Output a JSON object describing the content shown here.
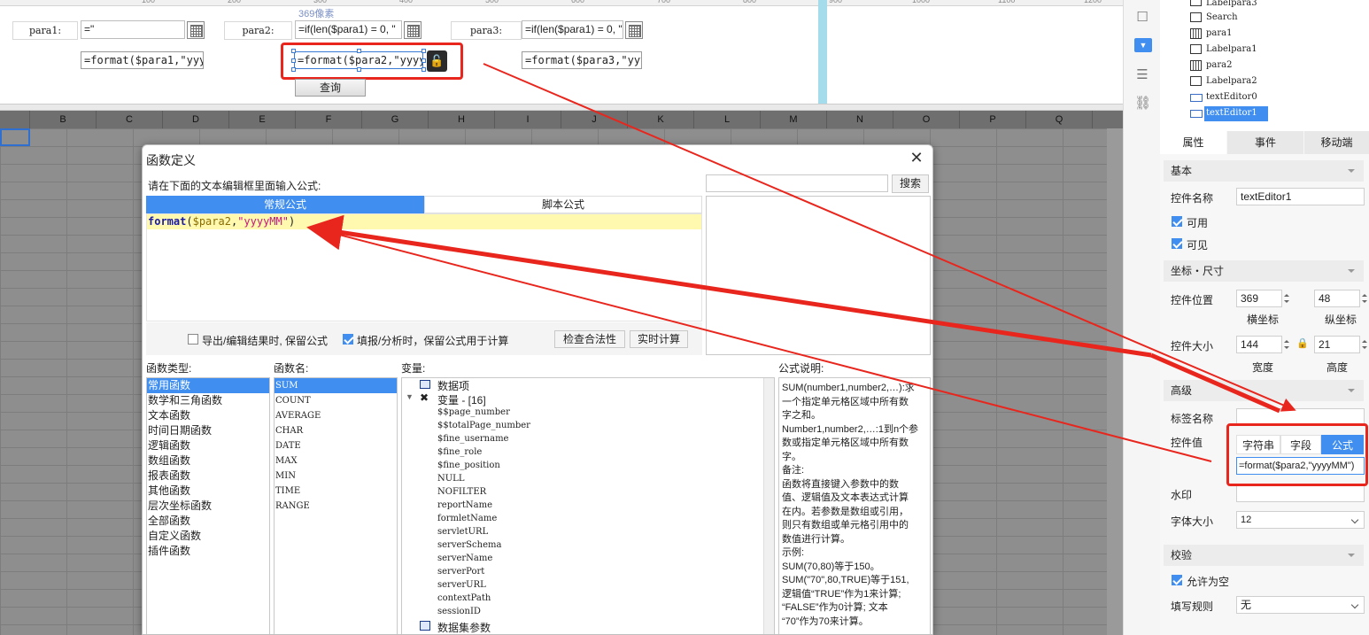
{
  "ruler": {
    "ticks": [
      "100",
      "200",
      "300",
      "400",
      "500",
      "600",
      "700",
      "800",
      "900",
      "1000",
      "1100",
      "1200"
    ]
  },
  "design": {
    "pixel_hint": "369像素",
    "params": [
      {
        "label": "para1:",
        "value": "=\""
      },
      {
        "label": "para2:",
        "value": "=if(len($para1) = 0, \""
      },
      {
        "label": "para3:",
        "value": "=if(len($para1) = 0, \""
      }
    ],
    "formats": [
      "=format($para1,\"yyyy",
      "=format($para2,\"yyyy",
      "=format($para3,\"yyyy"
    ],
    "query_button": "查询"
  },
  "sheet": {
    "columns": [
      "B",
      "C",
      "D",
      "E",
      "F",
      "G",
      "H",
      "I",
      "J",
      "K",
      "L",
      "M",
      "N",
      "O",
      "P",
      "Q"
    ]
  },
  "dialog": {
    "title": "函数定义",
    "prompt": "请在下面的文本编辑框里面输入公式:",
    "search_button": "搜索",
    "tabs": {
      "normal": "常规公式",
      "script": "脚本公式"
    },
    "formula": {
      "fn": "format",
      "open": "(",
      "var": "$para2",
      "comma": ",",
      "str": "\"yyyyMM\"",
      "close": ")"
    },
    "options": {
      "keep_formula_export": "导出/编辑结果时, 保留公式",
      "keep_formula_fill": "填报/分析时，保留公式用于计算",
      "check_button": "检查合法性",
      "realtime_button": "实时计算"
    },
    "labels": {
      "types": "函数类型:",
      "names": "函数名:",
      "vars": "变量:",
      "desc": "公式说明:"
    },
    "function_types": [
      "常用函数",
      "数学和三角函数",
      "文本函数",
      "时间日期函数",
      "逻辑函数",
      "数组函数",
      "报表函数",
      "其他函数",
      "层次坐标函数",
      "全部函数",
      "自定义函数",
      "插件函数"
    ],
    "function_names": [
      "SUM",
      "COUNT",
      "AVERAGE",
      "CHAR",
      "DATE",
      "MAX",
      "MIN",
      "TIME",
      "RANGE"
    ],
    "variables": {
      "data_item": "数据项",
      "var_group": "变量 - [16]",
      "items": [
        "$$page_number",
        "$$totalPage_number",
        "$fine_username",
        "$fine_role",
        "$fine_position",
        "NULL",
        "NOFILTER",
        "reportName",
        "formletName",
        "servletURL",
        "serverSchema",
        "serverName",
        "serverPort",
        "serverURL",
        "contextPath",
        "sessionID"
      ],
      "dataset_params": "数据集参数"
    },
    "description": [
      "SUM(number1,number2,…):求",
      "一个指定单元格区域中所有数",
      "字之和。",
      "Number1,number2,…:1到n个参",
      "数或指定单元格区域中所有数",
      "字。",
      "备注:",
      "函数将直接键入参数中的数",
      "值、逻辑值及文本表达式计算",
      "在内。若参数是数组或引用，",
      "则只有数组或单元格引用中的",
      "数值进行计算。",
      "示例:",
      "SUM(70,80)等于150。",
      "SUM(\"70\",80,TRUE)等于151,",
      "逻辑值“TRUE”作为1来计算;",
      "“FALSE”作为0计算; 文本",
      "“70”作为70来计算。"
    ]
  },
  "tree": {
    "items": [
      "Labelpara3",
      "Search",
      "para1",
      "Labelpara1",
      "para2",
      "Labelpara2",
      "textEditor0",
      "textEditor1"
    ]
  },
  "props": {
    "tabs": [
      "属性",
      "事件",
      "移动端"
    ],
    "sections": {
      "basic": "基本",
      "geometry": "坐标・尺寸",
      "advanced": "高级",
      "validate": "校验"
    },
    "name_label": "控件名称",
    "name_value": "textEditor1",
    "enabled": "可用",
    "visible": "可见",
    "pos_label": "控件位置",
    "pos_x": "369",
    "pos_y": "48",
    "x_label": "横坐标",
    "y_label": "纵坐标",
    "size_label": "控件大小",
    "width": "144",
    "height": "21",
    "w_label": "宽度",
    "h_label": "高度",
    "tag_label": "标签名称",
    "value_label": "控件值",
    "value_modes": [
      "字符串",
      "字段",
      "公式"
    ],
    "value_formula": "=format($para2,\"yyyyMM\")",
    "watermark_label": "水印",
    "font_size_label": "字体大小",
    "font_size": "12",
    "allow_empty": "允许为空",
    "fill_rule_label": "填写规则",
    "fill_rule": "无"
  },
  "colors": {
    "accent": "#3f8ef0",
    "annotation": "#e8261d",
    "editor_highlight": "#fff9b0"
  }
}
